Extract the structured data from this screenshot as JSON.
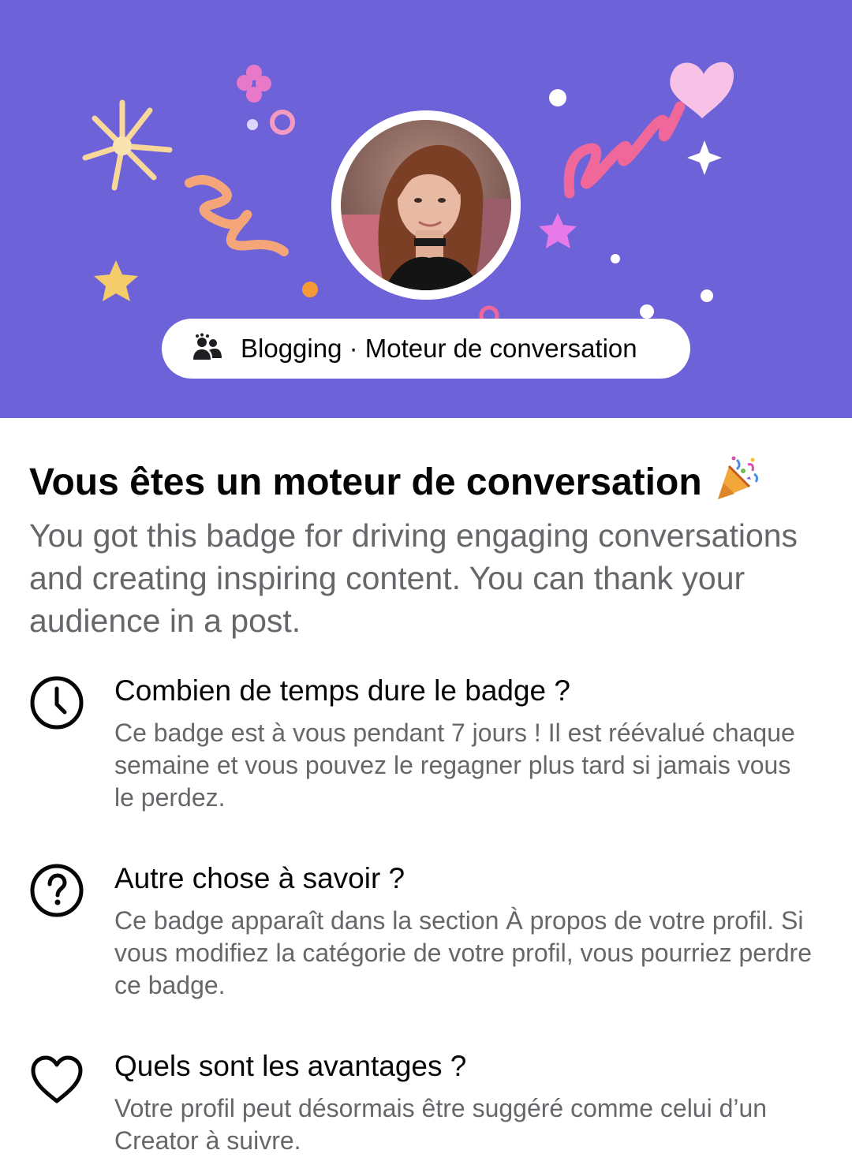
{
  "banner": {
    "background_color": "#6e62d8",
    "avatar_alt": "profile-photo",
    "pill": {
      "icon": "people-icon",
      "label": "Blogging · Moteur de conversation"
    }
  },
  "header": {
    "title": "Vous êtes un moteur de conversation",
    "title_emoji": "party-popper-icon",
    "description": "You got this badge for driving engaging conversations and creating inspiring content. You can thank your audience in a post."
  },
  "faq": [
    {
      "icon": "clock-icon",
      "question": "Combien de temps dure le badge ?",
      "answer": "Ce badge est à vous pendant 7 jours ! Il est réévalué chaque semaine et vous pouvez le regagner plus tard si jamais vous le perdez."
    },
    {
      "icon": "question-icon",
      "question": "Autre chose à savoir ?",
      "answer": "Ce badge apparaît dans la section À propos de votre profil. Si vous modifiez la catégorie de votre profil, vous pourriez perdre ce badge."
    },
    {
      "icon": "heart-icon",
      "question": "Quels sont les avantages ?",
      "answer": "Votre profil peut désormais être suggéré comme celui d’un Creator à suivre."
    }
  ]
}
